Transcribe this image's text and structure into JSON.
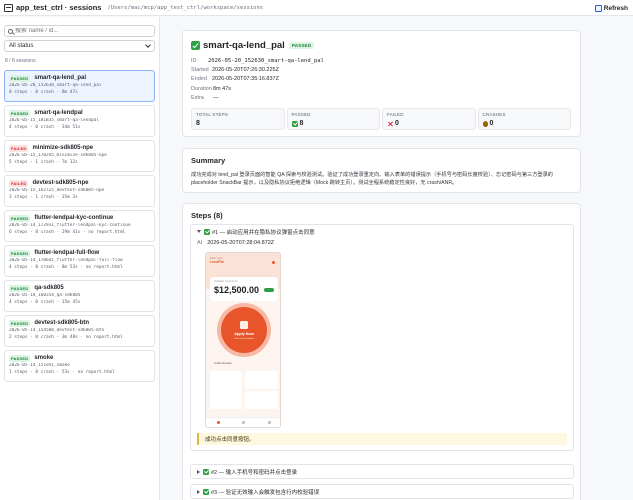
{
  "header": {
    "title": "app_test_ctrl · sessions",
    "path": "/Users/mac/mcp/app_test_ctrl/workspace/sessions",
    "refresh_label": "Refresh"
  },
  "sidebar": {
    "search_placeholder": "搜索 name / id...",
    "status_filter": "All status",
    "count_text": "8 / 8 sessions",
    "sessions": [
      {
        "status": "PASSED",
        "name": "smart-qa-lend_pal",
        "id": "2026-05-20_152630_smart-qa-lend_pal",
        "meta": "8 steps · 0 crash · 8m 47s"
      },
      {
        "status": "PASSED",
        "name": "smart-qa-lendpal",
        "id": "2026-05-15_181835_smart-qa-lendpal",
        "meta": "4 steps · 0 crash · 34m 51s"
      },
      {
        "status": "FAILED",
        "name": "minimize-sdk805-npe",
        "id": "2026-05-15_170245_minimize-sdk805-npe",
        "meta": "5 steps · 1 crash · 7m 12s"
      },
      {
        "status": "FAILED",
        "name": "devtest-sdk805-npe",
        "id": "2026-05-15_162725_devtest-sdk805-npe",
        "meta": "3 steps · 1 crash · 35m 3s"
      },
      {
        "status": "PASSED",
        "name": "flutter-lendpal-kyc-continue",
        "id": "2026-05-14_172931_flutter-lendpal-kyc-continue",
        "meta": "6 steps · 0 crash · 29m 41s · no report.html"
      },
      {
        "status": "PASSED",
        "name": "flutter-lendpal-full-flow",
        "id": "2026-05-14_170641_flutter-lendpal-full-flow",
        "meta": "4 steps · 0 crash · 8m 53s · no report.html"
      },
      {
        "status": "PASSED",
        "name": "qa-sdk805",
        "id": "2026-05-14_160354_qa-sdk805",
        "meta": "4 steps · 0 crash · 15m 45s"
      },
      {
        "status": "PASSED",
        "name": "devtest-sdk805-btn",
        "id": "2026-05-14_154508_devtest-sdk805-btn",
        "meta": "2 steps · 0 crash · 3m 48s · no report.html"
      },
      {
        "status": "PASSED",
        "name": "smoke",
        "id": "2026-05-14_151941_smoke",
        "meta": "1 steps · 0 crash · 53s · no report.html"
      }
    ]
  },
  "detail": {
    "title": "smart-qa-lend_pal",
    "status": "PASSED",
    "fields": [
      {
        "key": "ID",
        "value": "2026-05-20_152630_smart-qa-lend_pal"
      },
      {
        "key": "Started",
        "value": "2026-05-20T07:26:30.225Z"
      },
      {
        "key": "Ended",
        "value": "2026-05-20T07:35:16.837Z"
      },
      {
        "key": "Duration",
        "value": "8m 47s"
      },
      {
        "key": "Extra",
        "value": "—"
      }
    ],
    "stats": [
      {
        "label": "TOTAL STEPS",
        "value": "8",
        "icon": ""
      },
      {
        "label": "PASSED",
        "value": "8",
        "icon": "check"
      },
      {
        "label": "FAILED",
        "value": "0",
        "icon": "cross"
      },
      {
        "label": "CRASHES",
        "value": "0",
        "icon": "bug"
      }
    ]
  },
  "summary": {
    "heading": "Summary",
    "text": "成功完成对 lend_pal 登录页面的智能 QA 探索与校验测试。验证了成功登录重定向、输入表单的错误提示（手机号与密码长度校验）、忘记密码与第三方登录的 placeholder SnackBar 提示，以及隐私协议拒绝逻辑（Mock 跳转主页）。测试全程系统稳定性良好，无 crash/ANR。"
  },
  "steps": {
    "heading": "Steps (8)",
    "items": [
      {
        "title": "#1 — 启动应用并在隐私协议弹窗点击同意",
        "at_label": "At",
        "at": "2026-05-20T07:28:04.872Z",
        "note": "成功点击同意按钮。"
      },
      {
        "title": "#2 — 输入手机号和密码并点击登录"
      },
      {
        "title": "#3 — 验证无效输入会触发包含行内校验错误"
      }
    ],
    "phone": {
      "greeting": "Hello, User",
      "brand": "LendPal",
      "card_label": "Available Credit Limit",
      "amount": "$12,500.00",
      "cta": "Apply Now",
      "cta_sub": "Get cash in minutes",
      "row_text": "Under Review",
      "nav": [
        "Home",
        "Loans",
        "Profile"
      ]
    }
  }
}
